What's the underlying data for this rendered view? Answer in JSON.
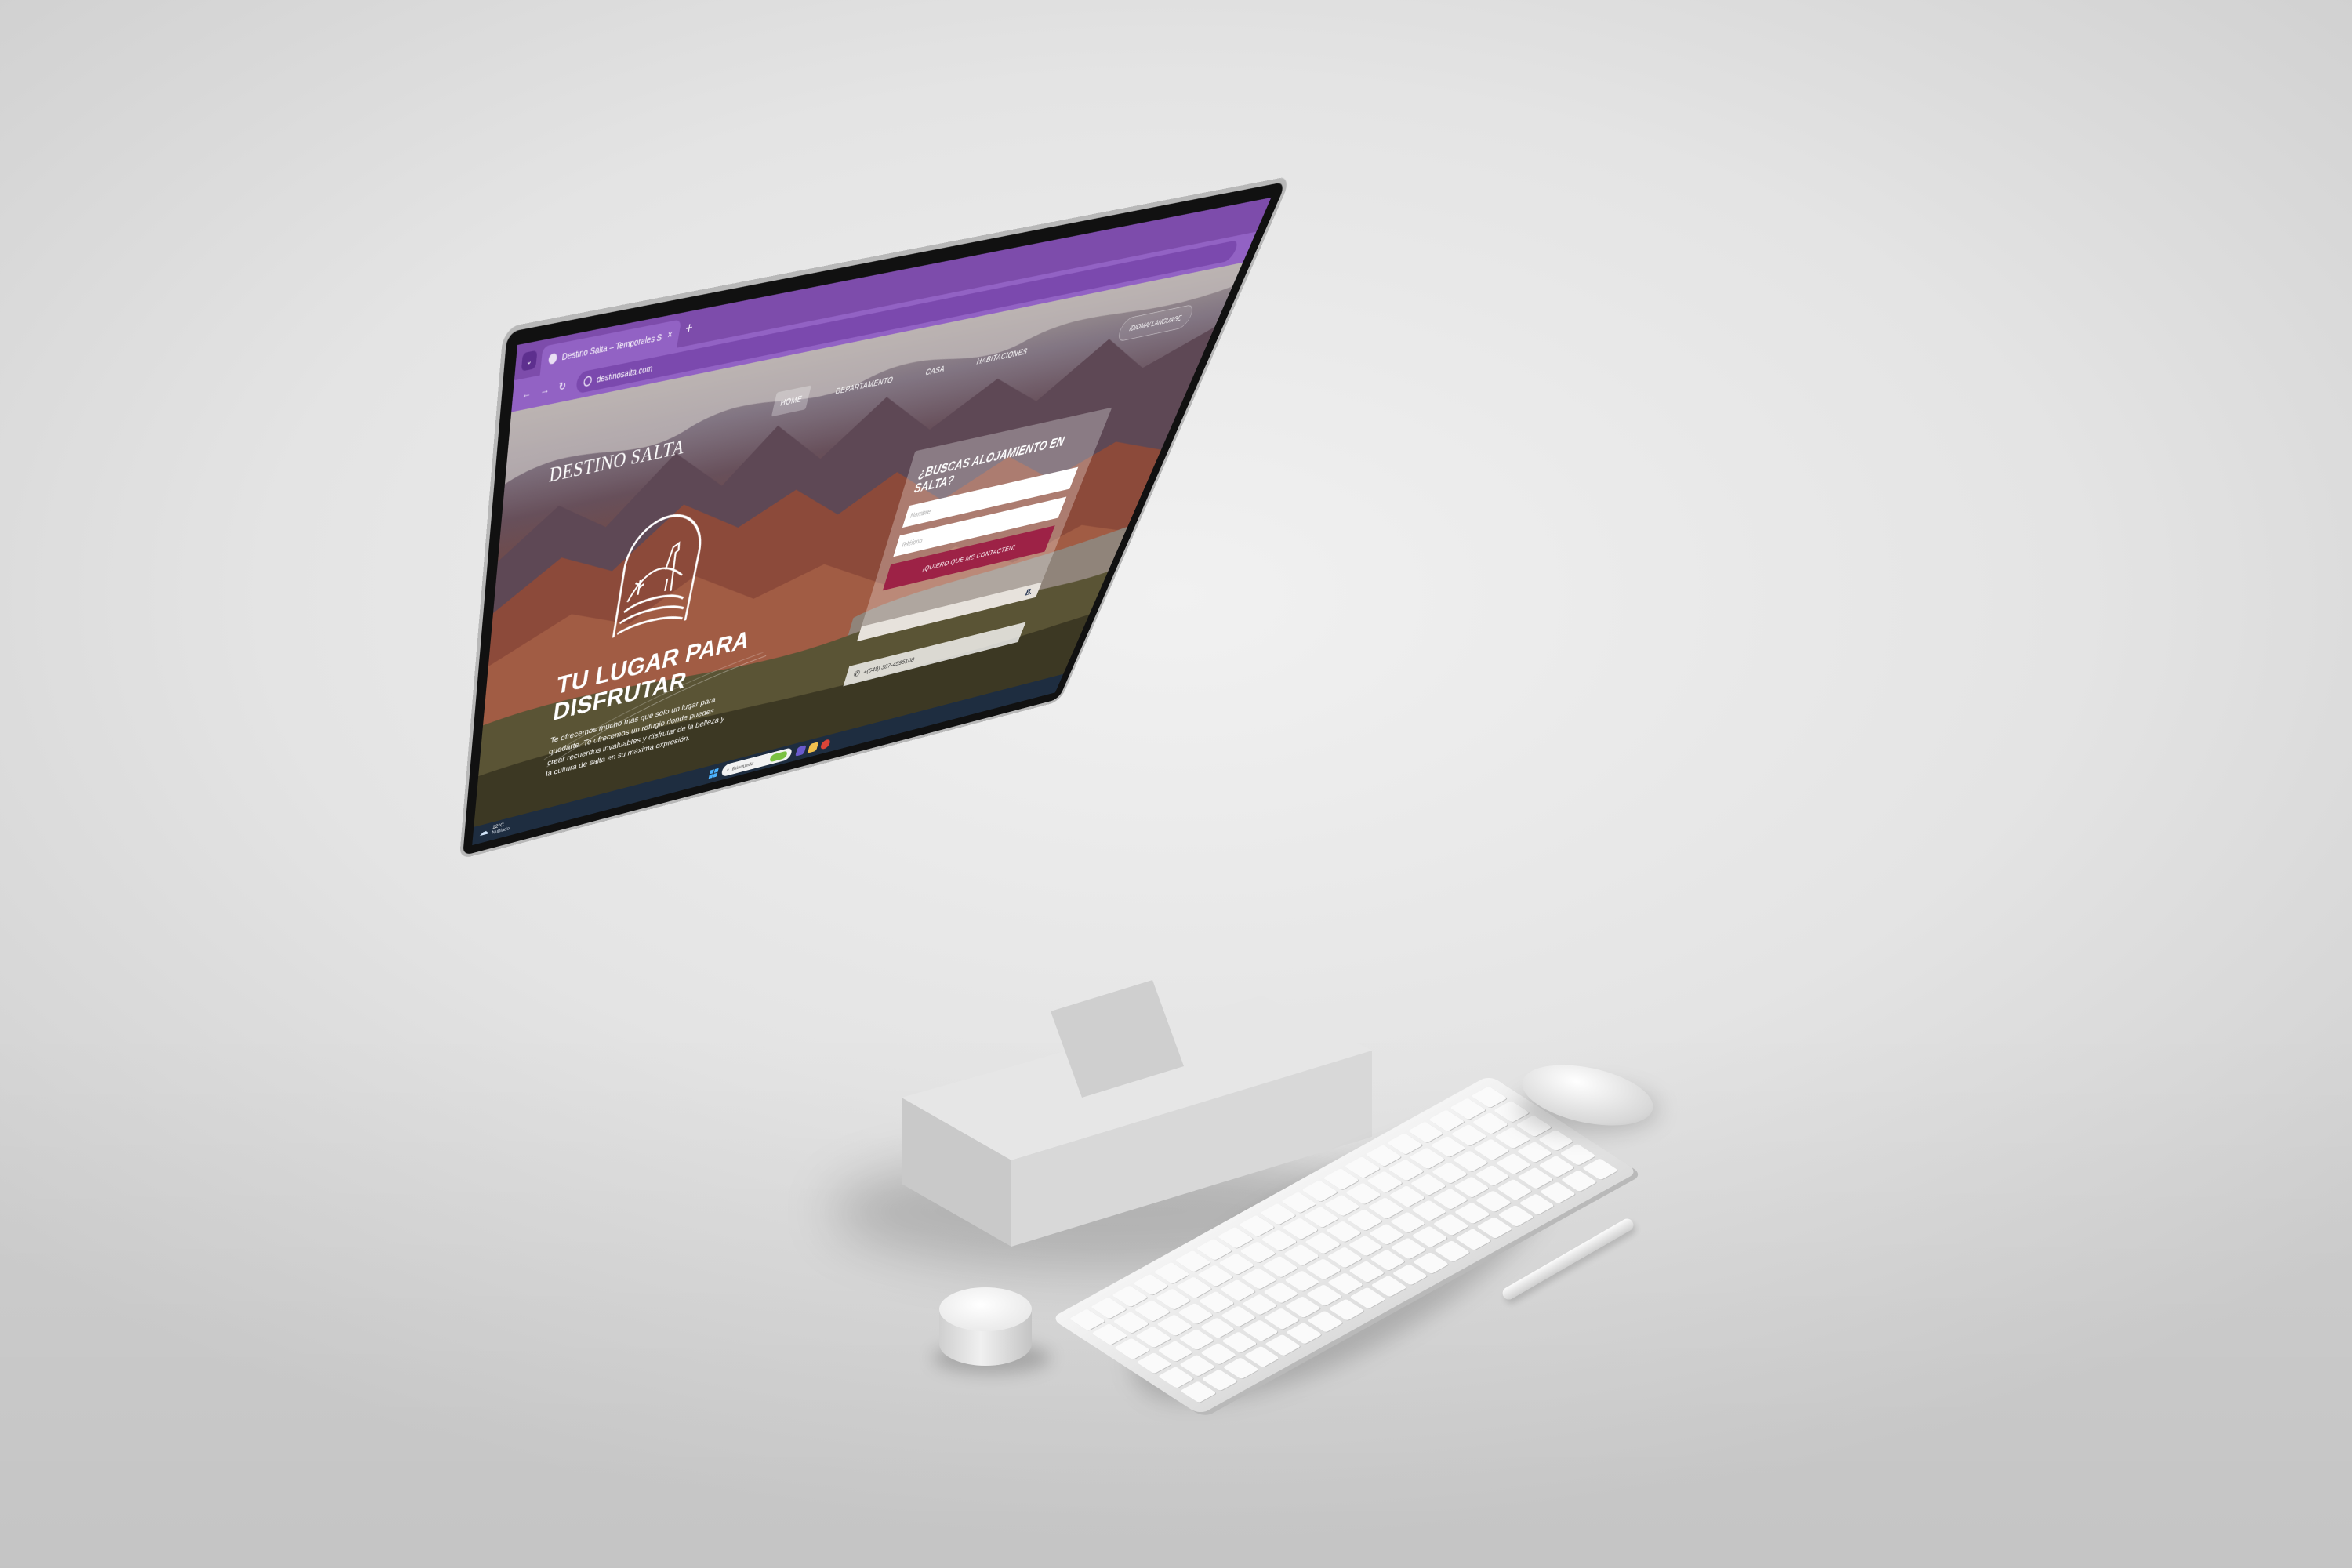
{
  "browser": {
    "tab_menu_icon": "chevron-down-icon",
    "tab_title": "Destino Salta – Temporales Sal",
    "tab_close": "×",
    "new_tab": "+",
    "back": "←",
    "forward": "→",
    "reload": "↻",
    "url": "destinosalta.com"
  },
  "site": {
    "brand": "DESTINO SALTA",
    "nav": {
      "home": "HOME",
      "departamento": "DEPARTAMENTO",
      "casa": "CASA",
      "habitaciones": "HABITACIONES"
    },
    "language": "IDIOMA/ LANGUAGE",
    "hero": {
      "title": "TU LUGAR PARA DISFRUTAR",
      "text": "Te ofrecemos mucho más que solo un lugar para quedarte. Te ofrecemos un refugio donde puedes crear recuerdos invaluables y disfrutar de la belleza y la cultura de salta en su máxima expresión."
    },
    "form": {
      "title": "¿BUSCAS ALOJAMIENTO EN SALTA?",
      "name_placeholder": "Nombre",
      "phone_placeholder": "Teléfono",
      "submit": "¡QUIERO QUE ME CONTACTEN!",
      "booking_badge": "B."
    },
    "phone": "+(549) 387-4595108"
  },
  "taskbar": {
    "temperature": "12°C",
    "weather": "Nublado",
    "search": "Búsqueda"
  },
  "colors": {
    "browser_purple": "#7d4cab",
    "cta": "#9d2246",
    "taskbar": "#1e2d40"
  }
}
